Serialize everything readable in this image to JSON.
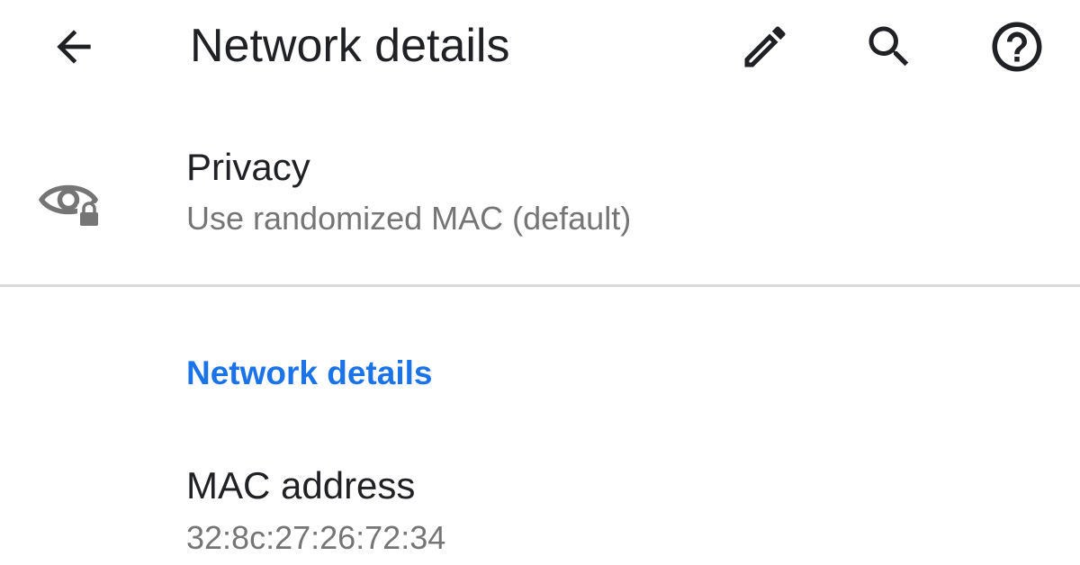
{
  "app_bar": {
    "title": "Network details",
    "icons": {
      "back": "arrow-back-icon",
      "edit": "pencil-icon",
      "search": "search-icon",
      "help": "help-circle-icon"
    }
  },
  "privacy": {
    "icon": "eye-lock-icon",
    "title": "Privacy",
    "summary": "Use randomized MAC (default)"
  },
  "section": {
    "header": "Network details"
  },
  "mac_address": {
    "title": "MAC address",
    "value": "32:8c:27:26:72:34"
  },
  "colors": {
    "text_primary": "#202124",
    "text_secondary": "#757575",
    "accent": "#1a73e8",
    "divider": "#dadada"
  }
}
